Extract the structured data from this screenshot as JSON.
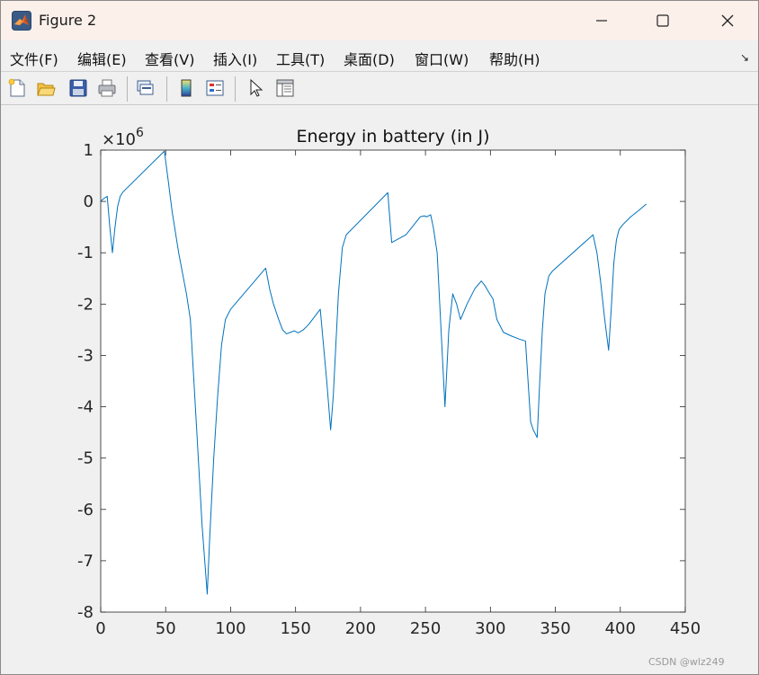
{
  "window": {
    "title": "Figure 2",
    "icon": "matlab-icon",
    "controls": [
      "minimize-icon",
      "maximize-icon",
      "close-icon"
    ]
  },
  "menubar": {
    "items": [
      {
        "label": "文件(F)"
      },
      {
        "label": "编辑(E)"
      },
      {
        "label": "查看(V)"
      },
      {
        "label": "插入(I)"
      },
      {
        "label": "工具(T)"
      },
      {
        "label": "桌面(D)"
      },
      {
        "label": "窗口(W)"
      },
      {
        "label": "帮助(H)"
      }
    ],
    "dock_icon": "dock-arrow-icon"
  },
  "toolbar": {
    "buttons": [
      "new-figure-icon",
      "open-file-icon",
      "save-icon",
      "print-icon",
      "link-plot-icon",
      "colorbar-icon",
      "legend-icon",
      "edit-plot-icon",
      "property-inspector-icon"
    ]
  },
  "chart_data": {
    "type": "line",
    "title": "Energy in battery (in J)",
    "exponent_label": "×10",
    "exponent_power": "6",
    "xlim": [
      0,
      450
    ],
    "ylim": [
      -8,
      1
    ],
    "xticks": [
      "0",
      "50",
      "100",
      "150",
      "200",
      "250",
      "300",
      "350",
      "400",
      "450"
    ],
    "yticks": [
      "1",
      "0",
      "-1",
      "-2",
      "-3",
      "-4",
      "-5",
      "-6",
      "-7",
      "-8"
    ],
    "xtick_values": [
      0,
      50,
      100,
      150,
      200,
      250,
      300,
      350,
      400,
      450
    ],
    "ytick_values": [
      1,
      0,
      -1,
      -2,
      -3,
      -4,
      -5,
      -6,
      -7,
      -8
    ],
    "grid": false,
    "line_color": "#0072bd",
    "series": [
      {
        "x": [
          0,
          2,
          5,
          7,
          9,
          11,
          13,
          15,
          17,
          49,
          52,
          55,
          60,
          66,
          69,
          74,
          78,
          82,
          84,
          87,
          90,
          93,
          96,
          100,
          127,
          130,
          133,
          137,
          140,
          143,
          146,
          149,
          152,
          156,
          160,
          169,
          174,
          177,
          179,
          181,
          183,
          186,
          189,
          221,
          224,
          235,
          246,
          249,
          251,
          254,
          256,
          259,
          262,
          265,
          268,
          271,
          274,
          277,
          282,
          288,
          293,
          296,
          299,
          302,
          305,
          310,
          316,
          322,
          327,
          331,
          333,
          336,
          338,
          340,
          342,
          345,
          348,
          379,
          382,
          385,
          388,
          391,
          393,
          395,
          397,
          399,
          402,
          408,
          414,
          420
        ],
        "y": [
          0,
          0.05,
          0.1,
          -0.5,
          -1.0,
          -0.5,
          -0.1,
          0.1,
          0.18,
          0.98,
          0.4,
          -0.2,
          -1.0,
          -1.8,
          -2.3,
          -4.5,
          -6.3,
          -7.65,
          -6.5,
          -5.0,
          -3.8,
          -2.8,
          -2.3,
          -2.1,
          -1.3,
          -1.7,
          -2.0,
          -2.3,
          -2.5,
          -2.58,
          -2.55,
          -2.52,
          -2.56,
          -2.5,
          -2.4,
          -2.1,
          -3.5,
          -4.45,
          -3.8,
          -2.8,
          -1.8,
          -0.9,
          -0.65,
          0.17,
          -0.8,
          -0.65,
          -0.3,
          -0.28,
          -0.3,
          -0.26,
          -0.5,
          -1.0,
          -2.5,
          -4.0,
          -2.5,
          -1.8,
          -2.0,
          -2.3,
          -2.0,
          -1.7,
          -1.55,
          -1.65,
          -1.78,
          -1.9,
          -2.3,
          -2.55,
          -2.62,
          -2.68,
          -2.72,
          -4.3,
          -4.45,
          -4.6,
          -3.5,
          -2.5,
          -1.8,
          -1.45,
          -1.35,
          -0.65,
          -1.0,
          -1.6,
          -2.3,
          -2.9,
          -2.1,
          -1.2,
          -0.75,
          -0.55,
          -0.45,
          -0.3,
          -0.18,
          -0.05
        ]
      }
    ]
  },
  "watermark": "CSDN @wlz249"
}
